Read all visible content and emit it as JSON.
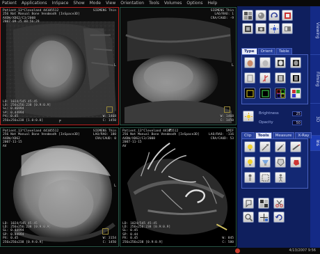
{
  "menu": [
    "Patient",
    "Applications",
    "InSpace",
    "Show",
    "Mode",
    "View",
    "Orientation",
    "Tools",
    "Volumes",
    "Options",
    "Help"
  ],
  "viewports": {
    "tl": {
      "info_left": [
        "Patient_13^Cleveland  44105512",
        "256 Nat Manual Bone Vendmodh [InSpace3D]",
        "AXDW/XD62/C3/2008",
        "2007-09-25 08:56:29"
      ],
      "info_right": [
        "SIEMENS Thin"
      ],
      "bottom_left": [
        "LD: 1024/545 45:45",
        "LD: 256x256:238 [0.9:0.9]",
        "SL: 0.46994",
        "SP: 0.44994",
        "PX: 0.45",
        "256x256x238 [1.0:0.0]"
      ],
      "bottom_right": [
        "W: 1468",
        "C: 1450"
      ],
      "orient_top": "",
      "orient_right": "L",
      "orient_bottom": "F",
      "cube": "F"
    },
    "tr": {
      "info_left": [],
      "info_right": [
        "SIEMENS Thin",
        "LAO/RAO: 1",
        "CRA/CAUD: -9"
      ],
      "bottom_left": [],
      "bottom_right": [
        "W: 1468",
        "C: 1450"
      ],
      "orient_top": "",
      "orient_right": "L",
      "orient_bottom": "",
      "cube": "A"
    },
    "bl": {
      "info_left": [
        "Patient_13^Cleveland  44105512",
        "256 Nat Manual Bone Vendmodh [InSpace3D]",
        "AXDW/XD62",
        "2007-11-15",
        "AV"
      ],
      "info_right": [
        "SIEMENS Thin",
        "LAO/RAO: 180",
        "CRA/CAUD: 0"
      ],
      "bottom_left": [
        "LD: 1024/545 45:45",
        "LD: 256x256:238 [0.9:0.9]",
        "SL: 0.44994",
        "SP: 0.44994",
        "PX: 0.45",
        "256x256x238 [0.9:0.9]"
      ],
      "bottom_right": [
        "W: 3154",
        "C: 1450"
      ],
      "orient_top": "",
      "orient_right": "L",
      "orient_bottom": "",
      "cube": "E"
    },
    "br": {
      "info_left": [
        "Patient_13^Cleveland  44105512",
        "256 Nat Manual Bone Vendmodh [InSpace3D]",
        "AXDW/XD62/C3/2008",
        "2007-11-15",
        "AV"
      ],
      "info_right": [
        "SMIF",
        "LAO/RAO: -116",
        "CRA/CAUD: 53"
      ],
      "bottom_left": [
        "LD: 1024/545 45:45",
        "LD: 256x256:238 [0.9:0.9]",
        "SL: 0.45",
        "SP: 0.44",
        "PX: 0.45",
        "256x256x238 [0.9:0.9]"
      ],
      "bottom_right": [
        "W: 845",
        "C: 580"
      ],
      "orient_top": "F",
      "orient_right": "",
      "orient_bottom": "",
      "cube": ""
    }
  },
  "right_panel": {
    "side_tabs": [
      "Viewing",
      "Filming",
      "3D",
      "Ins"
    ],
    "type_tabs": [
      "Type",
      "Orient",
      "Table"
    ],
    "sliders": [
      {
        "label": "Brightness",
        "value": "25"
      },
      {
        "label": "Opacity",
        "value": "50"
      }
    ],
    "clip_tabs": [
      "Clip",
      "Tools",
      "Measure",
      "X-Ray"
    ]
  },
  "status": {
    "clock": "4/13/2007 9:56"
  },
  "colors": {
    "panel_bg": "#0f1f5e",
    "active_viewport": "#c0201e",
    "viewport_border": "#2a5a4a"
  }
}
